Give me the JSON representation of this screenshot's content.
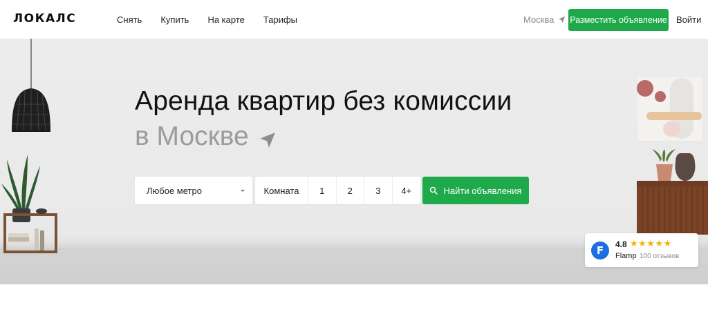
{
  "header": {
    "logo": "ЛОКАЛС",
    "nav": [
      "Снять",
      "Купить",
      "На карте",
      "Тарифы"
    ],
    "city": "Москва",
    "post_button": "Разместить объявление",
    "login": "Войти"
  },
  "hero": {
    "title_line1": "Аренда квартир без комиссии",
    "title_line2": "в Москве"
  },
  "search": {
    "metro_label": "Любое метро",
    "rooms_label": "Комната",
    "room_options": [
      "1",
      "2",
      "3",
      "4+"
    ],
    "find_button": "Найти объявления"
  },
  "flamp": {
    "rating": "4.8",
    "brand": "Flamp",
    "reviews": "100 отзывов",
    "stars": "★★★★★"
  },
  "icons": {
    "location": "location-arrow-icon",
    "search": "search-icon",
    "dropdown": "chevron-down-icon"
  },
  "colors": {
    "accent": "#1ea94a",
    "flamp_blue": "#1b6fe0",
    "star": "#f4b400"
  }
}
